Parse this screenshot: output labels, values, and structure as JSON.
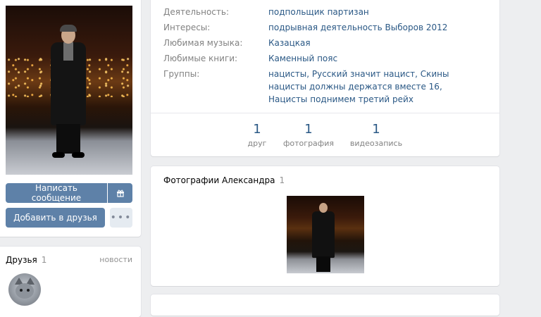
{
  "profile": {
    "buttons": {
      "write_message": "Написать сообщение",
      "add_friend": "Добавить в друзья",
      "more": "•••"
    }
  },
  "friends": {
    "title": "Друзья",
    "count": "1",
    "news_link": "новости"
  },
  "info": {
    "rows": [
      {
        "key": "Деятельность:",
        "value": "подпольщик партизан"
      },
      {
        "key": "Интересы:",
        "value": "подрывная деятельность Выборов 2012"
      },
      {
        "key": "Любимая музыка:",
        "value": "Казацкая"
      },
      {
        "key": "Любимые книги:",
        "value": "Каменный пояс"
      },
      {
        "key": "Группы:",
        "value": "нацисты, Русский значит нацист, Скины нацисты должны держатся вместе 16, Нацисты поднимем третий рейх"
      }
    ],
    "counters": [
      {
        "num": "1",
        "label": "друг"
      },
      {
        "num": "1",
        "label": "фотография"
      },
      {
        "num": "1",
        "label": "видеозапись"
      }
    ]
  },
  "photos": {
    "title": "Фотографии Александра",
    "count": "1"
  },
  "colors": {
    "background": "#edeef0",
    "link": "#2a5885",
    "button_primary": "#5e81a8",
    "button_secondary": "#e5ebf1",
    "muted_text": "#828282"
  },
  "icons": {
    "gift": "gift-icon",
    "more": "more-dots-icon"
  }
}
